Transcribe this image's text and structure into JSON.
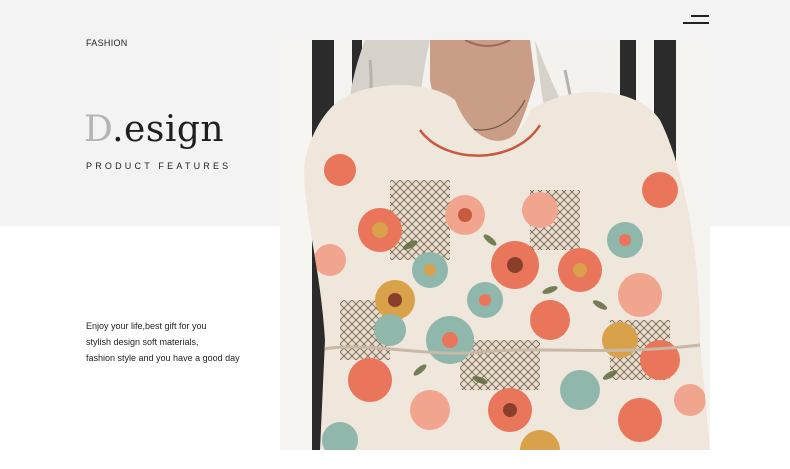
{
  "header": {
    "section_label": "FASHION",
    "menu_icon": "hamburger-menu-icon"
  },
  "hero": {
    "title_initial": "D",
    "title_rest": ".esign",
    "subtitle": "PRODUCT FEATURES"
  },
  "description": {
    "lines": [
      "Enjoy your life,best gift for you",
      "stylish design soft materials,",
      "fashion style and you have a good day"
    ]
  },
  "photo": {
    "subject": "model-wearing-floral-dress",
    "colors": {
      "background_band": "#f3f3f4",
      "dress_base": "#efe6dc",
      "flower_coral": "#e9765a",
      "flower_sage": "#8fb7ac",
      "flower_mustard": "#d9a24a",
      "stripe_dark": "#2b2b2b"
    }
  }
}
